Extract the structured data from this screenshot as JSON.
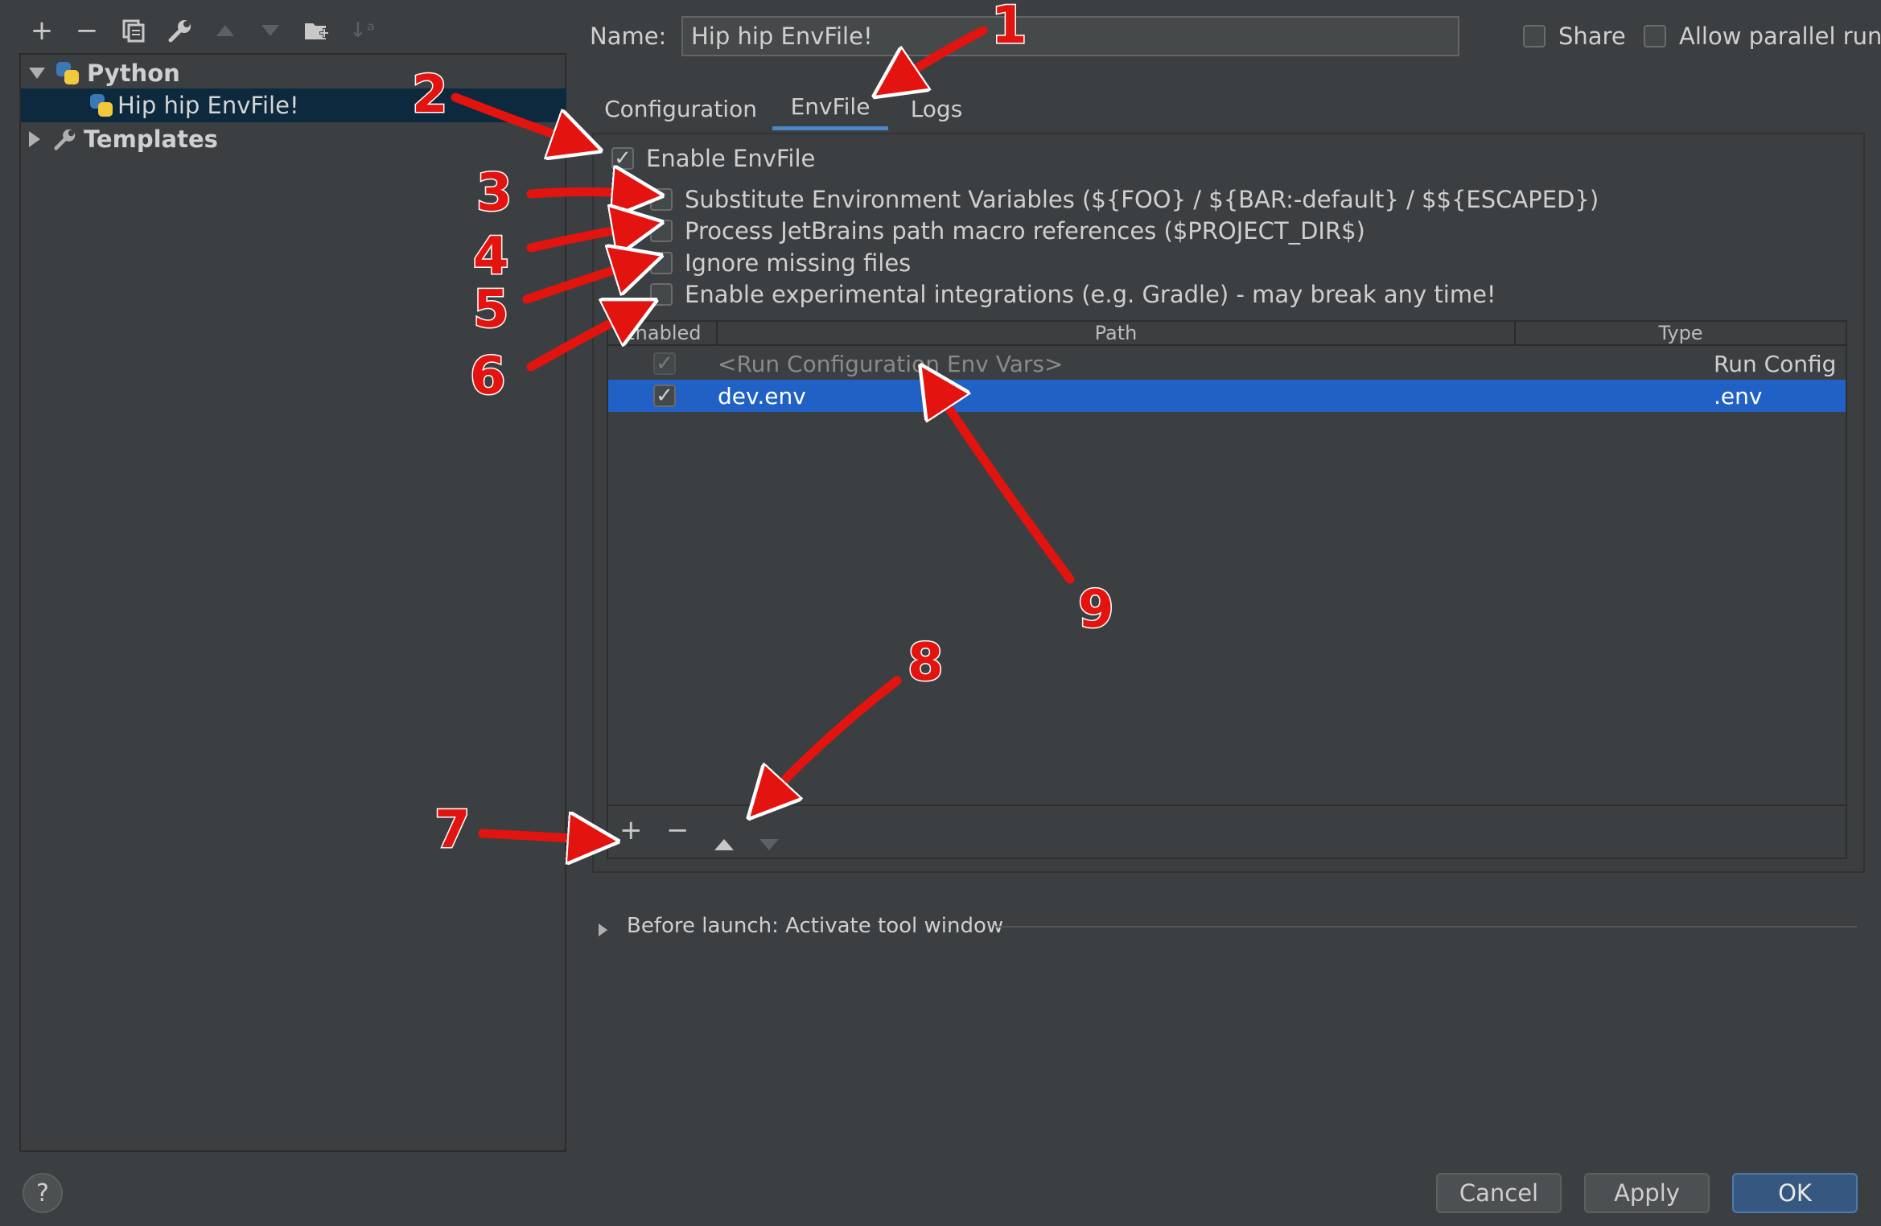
{
  "toolbar": {
    "icons": [
      "plus-icon",
      "minus-icon",
      "copy-icon",
      "wrench-icon",
      "arrow-up-icon",
      "arrow-down-icon",
      "folder-add-icon",
      "sort-icon"
    ]
  },
  "tree": {
    "python_label": "Python",
    "config_label": "Hip hip EnvFile!",
    "templates_label": "Templates"
  },
  "header": {
    "name_label": "Name:",
    "name_value": "Hip hip EnvFile!",
    "share_label": "Share",
    "parallel_label": "Allow parallel run"
  },
  "tabs": [
    {
      "label": "Configuration"
    },
    {
      "label": "EnvFile"
    },
    {
      "label": "Logs"
    }
  ],
  "options": {
    "enable": "Enable EnvFile",
    "substitute": "Substitute Environment Variables (${FOO} / ${BAR:-default} / $${ESCAPED})",
    "macro": "Process JetBrains path macro references ($PROJECT_DIR$)",
    "ignore": "Ignore missing files",
    "experimental": "Enable experimental integrations (e.g. Gradle) - may break any time!"
  },
  "table": {
    "headers": {
      "enabled": "Enabled",
      "path": "Path",
      "type": "Type"
    },
    "rows": [
      {
        "enabled": true,
        "path": "<Run Configuration Env Vars>",
        "type": "Run Config"
      },
      {
        "enabled": true,
        "path": "dev.env",
        "type": ".env"
      }
    ]
  },
  "before_launch": "Before launch: Activate tool window",
  "buttons": {
    "cancel": "Cancel",
    "apply": "Apply",
    "ok": "OK",
    "help": "?"
  },
  "annotations": [
    "1",
    "2",
    "3",
    "4",
    "5",
    "6",
    "7",
    "8",
    "9"
  ],
  "colors": {
    "selection": "#2160c4",
    "accent": "#4a88c7",
    "annotation": "#e3140f"
  }
}
